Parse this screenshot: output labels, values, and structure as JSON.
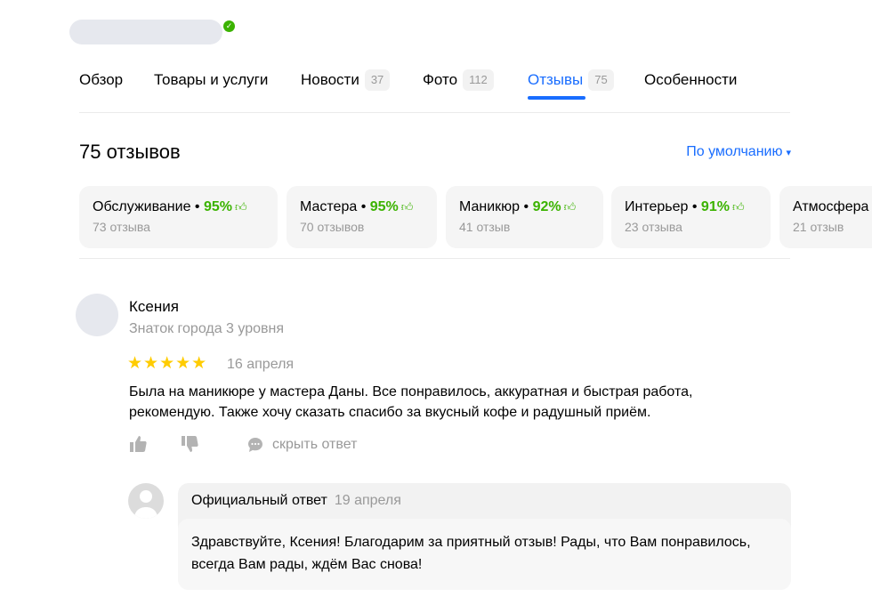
{
  "tabs": [
    {
      "label": "Обзор",
      "count": ""
    },
    {
      "label": "Товары и услуги",
      "count": ""
    },
    {
      "label": "Новости",
      "count": "37"
    },
    {
      "label": "Фото",
      "count": "112"
    },
    {
      "label": "Отзывы",
      "count": "75",
      "active": true
    },
    {
      "label": "Особенности",
      "count": ""
    }
  ],
  "reviews": {
    "title": "75 отзывов",
    "sort_label": "По умолчанию",
    "sort_arrow": "▾"
  },
  "aspects": [
    {
      "name": "Обслуживание",
      "sep": " • ",
      "percent": "95%",
      "count": "73 отзыва"
    },
    {
      "name": "Мастера",
      "sep": " • ",
      "percent": "95%",
      "count": "70 отзывов"
    },
    {
      "name": "Маникюр",
      "sep": " • ",
      "percent": "92%",
      "count": "41 отзыв"
    },
    {
      "name": "Интерьер",
      "sep": " • ",
      "percent": "91%",
      "count": "23 отзыва"
    },
    {
      "name": "Атмосфера",
      "sep": "",
      "percent": "",
      "count": "21 отзыв"
    }
  ],
  "review": {
    "author": "Ксения",
    "level": "Знаток города 3 уровня",
    "rating": 5,
    "stars": "★★★★★",
    "date": "16 апреля",
    "text": "Была на маникюре у мастера Даны. Все понравилось, аккуратная и быстрая работа, рекомендую. Также хочу сказать спасибо за вкусный кофе и радушный приём.",
    "hide_reply_label": "скрыть ответ"
  },
  "reply": {
    "title": "Официальный ответ",
    "date": "19 апреля",
    "text": "Здравствуйте, Ксения! Благодарим за приятный отзыв! Рады, что Вам понравилось, всегда Вам рады, ждём Вас снова!"
  },
  "colors": {
    "accent": "#196dff",
    "positive": "#3bb300",
    "star": "#ffcc00",
    "muted": "#999999"
  },
  "icons": {
    "verified": "verified-check-icon",
    "like": "thumb-up-icon",
    "dislike": "thumb-down-icon",
    "comment": "comment-icon",
    "aspect_thumb": "thumb-up-icon"
  }
}
